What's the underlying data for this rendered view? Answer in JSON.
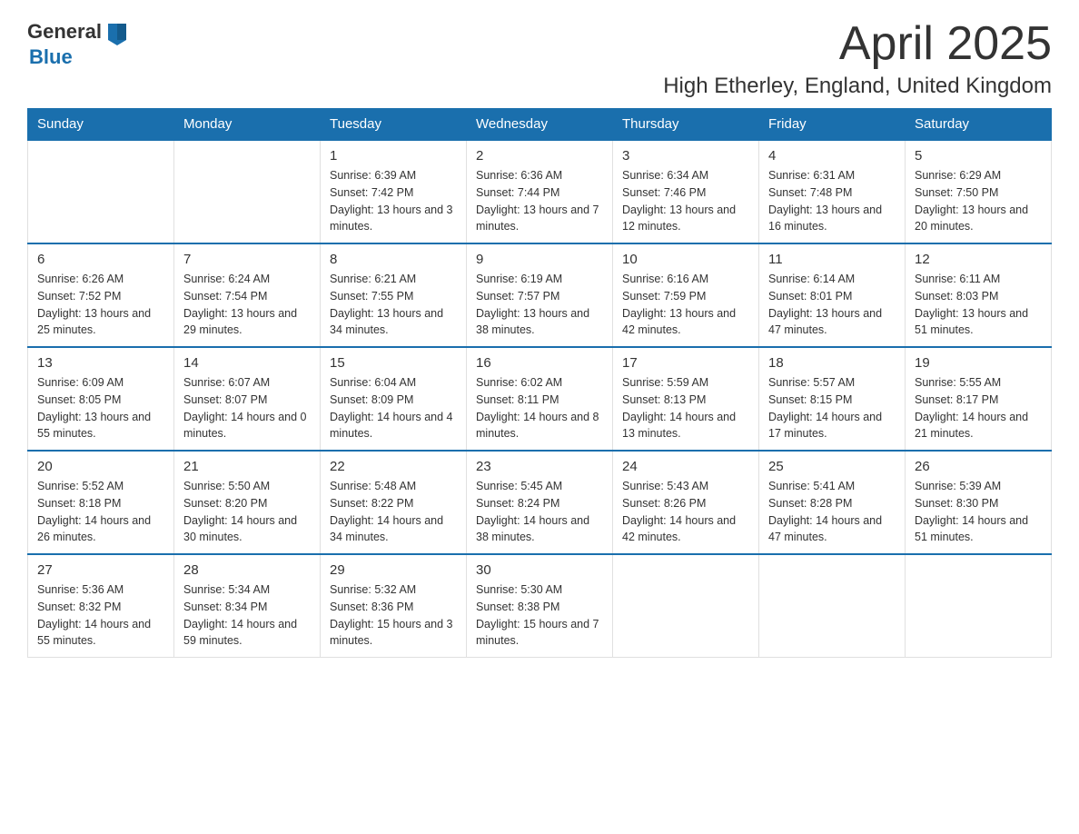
{
  "header": {
    "logo_general": "General",
    "logo_blue": "Blue",
    "title": "April 2025",
    "subtitle": "High Etherley, England, United Kingdom"
  },
  "weekdays": [
    "Sunday",
    "Monday",
    "Tuesday",
    "Wednesday",
    "Thursday",
    "Friday",
    "Saturday"
  ],
  "weeks": [
    [
      {
        "day": "",
        "sunrise": "",
        "sunset": "",
        "daylight": ""
      },
      {
        "day": "",
        "sunrise": "",
        "sunset": "",
        "daylight": ""
      },
      {
        "day": "1",
        "sunrise": "Sunrise: 6:39 AM",
        "sunset": "Sunset: 7:42 PM",
        "daylight": "Daylight: 13 hours and 3 minutes."
      },
      {
        "day": "2",
        "sunrise": "Sunrise: 6:36 AM",
        "sunset": "Sunset: 7:44 PM",
        "daylight": "Daylight: 13 hours and 7 minutes."
      },
      {
        "day": "3",
        "sunrise": "Sunrise: 6:34 AM",
        "sunset": "Sunset: 7:46 PM",
        "daylight": "Daylight: 13 hours and 12 minutes."
      },
      {
        "day": "4",
        "sunrise": "Sunrise: 6:31 AM",
        "sunset": "Sunset: 7:48 PM",
        "daylight": "Daylight: 13 hours and 16 minutes."
      },
      {
        "day": "5",
        "sunrise": "Sunrise: 6:29 AM",
        "sunset": "Sunset: 7:50 PM",
        "daylight": "Daylight: 13 hours and 20 minutes."
      }
    ],
    [
      {
        "day": "6",
        "sunrise": "Sunrise: 6:26 AM",
        "sunset": "Sunset: 7:52 PM",
        "daylight": "Daylight: 13 hours and 25 minutes."
      },
      {
        "day": "7",
        "sunrise": "Sunrise: 6:24 AM",
        "sunset": "Sunset: 7:54 PM",
        "daylight": "Daylight: 13 hours and 29 minutes."
      },
      {
        "day": "8",
        "sunrise": "Sunrise: 6:21 AM",
        "sunset": "Sunset: 7:55 PM",
        "daylight": "Daylight: 13 hours and 34 minutes."
      },
      {
        "day": "9",
        "sunrise": "Sunrise: 6:19 AM",
        "sunset": "Sunset: 7:57 PM",
        "daylight": "Daylight: 13 hours and 38 minutes."
      },
      {
        "day": "10",
        "sunrise": "Sunrise: 6:16 AM",
        "sunset": "Sunset: 7:59 PM",
        "daylight": "Daylight: 13 hours and 42 minutes."
      },
      {
        "day": "11",
        "sunrise": "Sunrise: 6:14 AM",
        "sunset": "Sunset: 8:01 PM",
        "daylight": "Daylight: 13 hours and 47 minutes."
      },
      {
        "day": "12",
        "sunrise": "Sunrise: 6:11 AM",
        "sunset": "Sunset: 8:03 PM",
        "daylight": "Daylight: 13 hours and 51 minutes."
      }
    ],
    [
      {
        "day": "13",
        "sunrise": "Sunrise: 6:09 AM",
        "sunset": "Sunset: 8:05 PM",
        "daylight": "Daylight: 13 hours and 55 minutes."
      },
      {
        "day": "14",
        "sunrise": "Sunrise: 6:07 AM",
        "sunset": "Sunset: 8:07 PM",
        "daylight": "Daylight: 14 hours and 0 minutes."
      },
      {
        "day": "15",
        "sunrise": "Sunrise: 6:04 AM",
        "sunset": "Sunset: 8:09 PM",
        "daylight": "Daylight: 14 hours and 4 minutes."
      },
      {
        "day": "16",
        "sunrise": "Sunrise: 6:02 AM",
        "sunset": "Sunset: 8:11 PM",
        "daylight": "Daylight: 14 hours and 8 minutes."
      },
      {
        "day": "17",
        "sunrise": "Sunrise: 5:59 AM",
        "sunset": "Sunset: 8:13 PM",
        "daylight": "Daylight: 14 hours and 13 minutes."
      },
      {
        "day": "18",
        "sunrise": "Sunrise: 5:57 AM",
        "sunset": "Sunset: 8:15 PM",
        "daylight": "Daylight: 14 hours and 17 minutes."
      },
      {
        "day": "19",
        "sunrise": "Sunrise: 5:55 AM",
        "sunset": "Sunset: 8:17 PM",
        "daylight": "Daylight: 14 hours and 21 minutes."
      }
    ],
    [
      {
        "day": "20",
        "sunrise": "Sunrise: 5:52 AM",
        "sunset": "Sunset: 8:18 PM",
        "daylight": "Daylight: 14 hours and 26 minutes."
      },
      {
        "day": "21",
        "sunrise": "Sunrise: 5:50 AM",
        "sunset": "Sunset: 8:20 PM",
        "daylight": "Daylight: 14 hours and 30 minutes."
      },
      {
        "day": "22",
        "sunrise": "Sunrise: 5:48 AM",
        "sunset": "Sunset: 8:22 PM",
        "daylight": "Daylight: 14 hours and 34 minutes."
      },
      {
        "day": "23",
        "sunrise": "Sunrise: 5:45 AM",
        "sunset": "Sunset: 8:24 PM",
        "daylight": "Daylight: 14 hours and 38 minutes."
      },
      {
        "day": "24",
        "sunrise": "Sunrise: 5:43 AM",
        "sunset": "Sunset: 8:26 PM",
        "daylight": "Daylight: 14 hours and 42 minutes."
      },
      {
        "day": "25",
        "sunrise": "Sunrise: 5:41 AM",
        "sunset": "Sunset: 8:28 PM",
        "daylight": "Daylight: 14 hours and 47 minutes."
      },
      {
        "day": "26",
        "sunrise": "Sunrise: 5:39 AM",
        "sunset": "Sunset: 8:30 PM",
        "daylight": "Daylight: 14 hours and 51 minutes."
      }
    ],
    [
      {
        "day": "27",
        "sunrise": "Sunrise: 5:36 AM",
        "sunset": "Sunset: 8:32 PM",
        "daylight": "Daylight: 14 hours and 55 minutes."
      },
      {
        "day": "28",
        "sunrise": "Sunrise: 5:34 AM",
        "sunset": "Sunset: 8:34 PM",
        "daylight": "Daylight: 14 hours and 59 minutes."
      },
      {
        "day": "29",
        "sunrise": "Sunrise: 5:32 AM",
        "sunset": "Sunset: 8:36 PM",
        "daylight": "Daylight: 15 hours and 3 minutes."
      },
      {
        "day": "30",
        "sunrise": "Sunrise: 5:30 AM",
        "sunset": "Sunset: 8:38 PM",
        "daylight": "Daylight: 15 hours and 7 minutes."
      },
      {
        "day": "",
        "sunrise": "",
        "sunset": "",
        "daylight": ""
      },
      {
        "day": "",
        "sunrise": "",
        "sunset": "",
        "daylight": ""
      },
      {
        "day": "",
        "sunrise": "",
        "sunset": "",
        "daylight": ""
      }
    ]
  ]
}
